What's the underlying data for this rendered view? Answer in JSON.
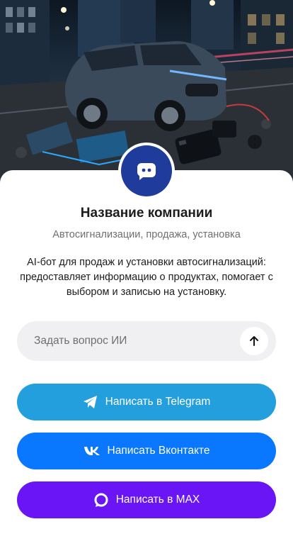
{
  "hero": {
    "icon": "car-alarm-hero-image"
  },
  "avatar": {
    "icon": "chat-bot-icon",
    "color": "#1f3b9c"
  },
  "company": {
    "name": "Название компании",
    "tagline": "Автосигнализации, продажа, установка",
    "description": "AI-бот для продаж и установки автосигнализаций: предоставляет информацию о продуктах, помогает с выбором и записью на установку."
  },
  "ask": {
    "placeholder": "Задать вопрос ИИ",
    "value": "",
    "send_icon": "arrow-up-icon"
  },
  "buttons": {
    "telegram": {
      "label": "Написать в Telegram",
      "icon": "telegram-icon",
      "color": "#229fdc"
    },
    "vk": {
      "label": "Написать Вконтакте",
      "icon": "vk-icon",
      "color": "#0a77ff"
    },
    "max": {
      "label": "Написать в MAX",
      "icon": "max-icon",
      "color": "#6a15f5"
    }
  }
}
